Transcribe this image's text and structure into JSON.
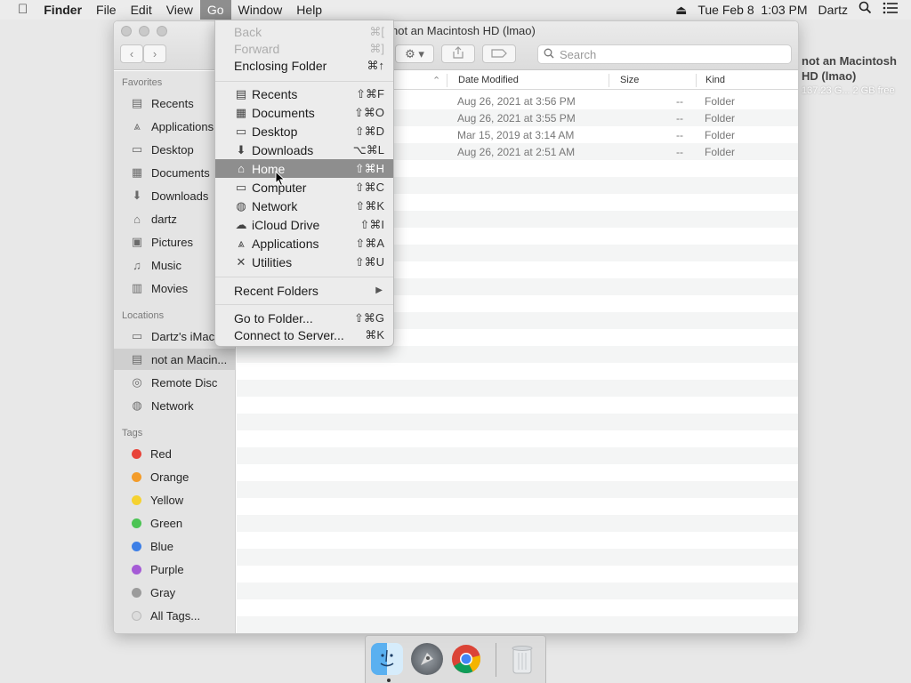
{
  "menubar": {
    "app_name": "Finder",
    "menus": [
      "File",
      "Edit",
      "View",
      "Go",
      "Window",
      "Help"
    ],
    "active_menu": "Go",
    "clock": "Tue Feb 8  1:03 PM",
    "user": "Dartz",
    "icons": [
      "apple-icon",
      "eject-icon",
      "spotlight-icon",
      "notification-center-icon"
    ]
  },
  "desktop": {
    "disk_name": "not an Macintosh HD (lmao)",
    "disk_info": "137.23 G... 2 GB free"
  },
  "window": {
    "title": "not an Macintosh HD (lmao)",
    "search_placeholder": "Search",
    "toolbar": {
      "back": "‹",
      "forward": "›",
      "action_icon": "gear-icon",
      "share_icon": "share-icon",
      "tag_icon": "tag-icon"
    }
  },
  "sidebar": {
    "favorites_heading": "Favorites",
    "favorites": [
      {
        "label": "Recents",
        "icon": "recents-icon",
        "glyph": "▤"
      },
      {
        "label": "Applications",
        "icon": "applications-icon",
        "glyph": "⩓"
      },
      {
        "label": "Desktop",
        "icon": "desktop-icon",
        "glyph": "▭"
      },
      {
        "label": "Documents",
        "icon": "documents-icon",
        "glyph": "▦"
      },
      {
        "label": "Downloads",
        "icon": "downloads-icon",
        "glyph": "⬇"
      },
      {
        "label": "dartz",
        "icon": "home-icon",
        "glyph": "⌂"
      },
      {
        "label": "Pictures",
        "icon": "pictures-icon",
        "glyph": "▣"
      },
      {
        "label": "Music",
        "icon": "music-icon",
        "glyph": "♫"
      },
      {
        "label": "Movies",
        "icon": "movies-icon",
        "glyph": "▥"
      }
    ],
    "locations_heading": "Locations",
    "locations": [
      {
        "label": "Dartz's iMac",
        "icon": "computer-icon",
        "glyph": "▭"
      },
      {
        "label": "not an Macin...",
        "icon": "disk-icon",
        "glyph": "▤",
        "selected": true
      },
      {
        "label": "Remote Disc",
        "icon": "disc-icon",
        "glyph": "◎"
      },
      {
        "label": "Network",
        "icon": "network-icon",
        "glyph": "◍"
      }
    ],
    "tags_heading": "Tags",
    "tags": [
      {
        "label": "Red",
        "color": "#e8443a"
      },
      {
        "label": "Orange",
        "color": "#f39c2a"
      },
      {
        "label": "Yellow",
        "color": "#f5d230"
      },
      {
        "label": "Green",
        "color": "#4cc454"
      },
      {
        "label": "Blue",
        "color": "#3d7fe6"
      },
      {
        "label": "Purple",
        "color": "#a55bd6"
      },
      {
        "label": "Gray",
        "color": "#9b9b9b"
      },
      {
        "label": "All Tags...",
        "color": "#dcdcdc"
      }
    ]
  },
  "list": {
    "columns": {
      "date": "Date Modified",
      "size": "Size",
      "kind": "Kind"
    },
    "rows": [
      {
        "date": "Aug 26, 2021 at 3:56 PM",
        "size": "--",
        "kind": "Folder"
      },
      {
        "date": "Aug 26, 2021 at 3:55 PM",
        "size": "--",
        "kind": "Folder"
      },
      {
        "date": "Mar 15, 2019 at 3:14 AM",
        "size": "--",
        "kind": "Folder"
      },
      {
        "date": "Aug 26, 2021 at 2:51 AM",
        "size": "--",
        "kind": "Folder"
      }
    ]
  },
  "go_menu": {
    "nav": [
      {
        "label": "Back",
        "shortcut": "⌘[",
        "disabled": true
      },
      {
        "label": "Forward",
        "shortcut": "⌘]",
        "disabled": true
      },
      {
        "label": "Enclosing Folder",
        "shortcut": "⌘↑"
      }
    ],
    "places": [
      {
        "label": "Recents",
        "shortcut": "⇧⌘F",
        "icon": "recents-icon",
        "glyph": "▤"
      },
      {
        "label": "Documents",
        "shortcut": "⇧⌘O",
        "icon": "documents-icon",
        "glyph": "▦"
      },
      {
        "label": "Desktop",
        "shortcut": "⇧⌘D",
        "icon": "desktop-icon",
        "glyph": "▭"
      },
      {
        "label": "Downloads",
        "shortcut": "⌥⌘L",
        "icon": "downloads-icon",
        "glyph": "⬇"
      },
      {
        "label": "Home",
        "shortcut": "⇧⌘H",
        "icon": "home-icon",
        "glyph": "⌂",
        "highlighted": true
      },
      {
        "label": "Computer",
        "shortcut": "⇧⌘C",
        "icon": "computer-icon",
        "glyph": "▭"
      },
      {
        "label": "Network",
        "shortcut": "⇧⌘K",
        "icon": "network-icon",
        "glyph": "◍"
      },
      {
        "label": "iCloud Drive",
        "shortcut": "⇧⌘I",
        "icon": "icloud-icon",
        "glyph": "☁"
      },
      {
        "label": "Applications",
        "shortcut": "⇧⌘A",
        "icon": "applications-icon",
        "glyph": "⩓"
      },
      {
        "label": "Utilities",
        "shortcut": "⇧⌘U",
        "icon": "utilities-icon",
        "glyph": "✕"
      }
    ],
    "recent_folders": "Recent Folders",
    "go_to_folder": {
      "label": "Go to Folder...",
      "shortcut": "⇧⌘G"
    },
    "connect_server": {
      "label": "Connect to Server...",
      "shortcut": "⌘K"
    }
  },
  "dock": {
    "apps": [
      {
        "name": "Finder",
        "icon": "finder-icon"
      },
      {
        "name": "Launchpad",
        "icon": "launchpad-icon"
      },
      {
        "name": "Chrome",
        "icon": "chrome-icon"
      },
      {
        "name": "Trash",
        "icon": "trash-icon"
      }
    ]
  }
}
